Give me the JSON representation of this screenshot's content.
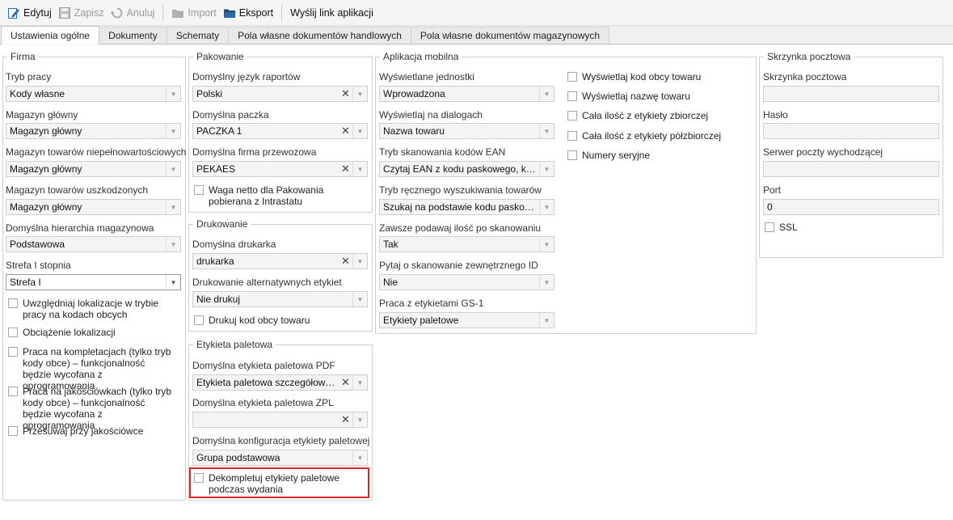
{
  "toolbar": {
    "edit": "Edytuj",
    "save": "Zapisz",
    "cancel": "Anuluj",
    "import": "Import",
    "export": "Eksport",
    "send_link": "Wyślij link aplikacji"
  },
  "tabs": [
    "Ustawienia ogólne",
    "Dokumenty",
    "Schematy",
    "Pola własne dokumentów handlowych",
    "Pola własne dokumentów magazynowych"
  ],
  "firma": {
    "legend": "Firma",
    "tryb_label": "Tryb pracy",
    "tryb_value": "Kody własne",
    "mag_glowny_label": "Magazyn główny",
    "mag_glowny_value": "Magazyn główny",
    "mag_niepeln_label": "Magazyn towarów niepełnowartościowych",
    "mag_niepeln_value": "Magazyn główny",
    "mag_uszk_label": "Magazyn towarów uszkodzonych",
    "mag_uszk_value": "Magazyn główny",
    "hierarchia_label": "Domyślna hierarchia magazynowa",
    "hierarchia_value": "Podstawowa",
    "strefa_label": "Strefa I stopnia",
    "strefa_value": "Strefa I",
    "chk_lokalizacje": "Uwzględniaj lokalizacje w trybie pracy na kodach obcych",
    "chk_obciazenie": "Obciążenie lokalizacji",
    "chk_kompletacje": "Praca na kompletacjach (tylko tryb kody obce) – funkcjonalność będzie wycofana z oprogramowania",
    "chk_jakosciowki": "Praca na jakościówkach (tylko tryb kody obce) – funkcjonalność będzie wycofana z oprogramowania",
    "chk_przesuwaj": "Przesuwaj przy jakościówce"
  },
  "pakowanie": {
    "legend": "Pakowanie",
    "jezyk_label": "Domyślny język raportów",
    "jezyk_value": "Polski",
    "paczka_label": "Domyślna paczka",
    "paczka_value": "PACZKA 1",
    "firma_label": "Domyślna firma przewozowa",
    "firma_value": "PEKAES",
    "chk_waga": "Waga netto dla Pakowania pobierana z Intrastatu"
  },
  "drukowanie": {
    "legend": "Drukowanie",
    "drukarka_label": "Domyślna drukarka",
    "drukarka_value": "drukarka",
    "alt_label": "Drukowanie alternatywnych etykiet",
    "alt_value": "Nie drukuj",
    "chk_kod": "Drukuj kod obcy towaru"
  },
  "etykieta": {
    "legend": "Etykieta paletowa",
    "pdf_label": "Domyślna etykieta paletowa PDF",
    "pdf_value": "Etykieta paletowa szczegółowa ...",
    "zpl_label": "Domyślna etykieta paletowa ZPL",
    "zpl_value": "",
    "konf_label": "Domyślna konfiguracja etykiety paletowej",
    "konf_value": "Grupa podstawowa",
    "chk_dekompletuj": "Dekompletuj etykiety paletowe podczas wydania"
  },
  "mobilna": {
    "legend": "Aplikacja mobilna",
    "jednostki_label": "Wyświetlane jednostki",
    "jednostki_value": "Wprowadzona",
    "dialogi_label": "Wyświetlaj na dialogach",
    "dialogi_value": "Nazwa towaru",
    "ean_label": "Tryb skanowania kodów EAN",
    "ean_value": "Czytaj EAN z kodu paskowego, kod...",
    "reczne_label": "Tryb ręcznego wyszukiwania towarów",
    "reczne_value": "Szukaj na podstawie kodu paskowe...",
    "ilosc_label": "Zawsze podawaj ilość po skanowaniu",
    "ilosc_value": "Tak",
    "pytaj_label": "Pytaj o skanowanie zewnętrznego ID",
    "pytaj_value": "Nie",
    "gs1_label": "Praca z etykietami GS-1",
    "gs1_value": "Etykiety paletowe",
    "chk_kod_obcy": "Wyświetlaj kod obcy towaru",
    "chk_nazwa": "Wyświetlaj nazwę towaru",
    "chk_zbiorcza": "Cała ilość z etykiety zbiorczej",
    "chk_polzbiorcza": "Cała ilość z etykiety półzbiorczej",
    "chk_seryjne": "Numery seryjne"
  },
  "skrzynka": {
    "legend": "Skrzynka pocztowa",
    "skrzynka_label": "Skrzynka pocztowa",
    "skrzynka_value": "",
    "haslo_label": "Hasło",
    "haslo_value": "",
    "serwer_label": "Serwer poczty wychodzącej",
    "serwer_value": "",
    "port_label": "Port",
    "port_value": "0",
    "chk_ssl": "SSL"
  },
  "colors": {
    "highlight": "#d9262c",
    "export_icon": "#1f4e79",
    "edit_icon": "#2b6cb0"
  },
  "icons": {
    "edit": "pencil-note-icon",
    "save": "floppy-disk-icon",
    "cancel": "undo-arrow-icon",
    "import": "folder-icon",
    "export": "folder-open-icon",
    "clear": "x-clear-icon",
    "dropdown": "dropdown-arrow-icon"
  }
}
